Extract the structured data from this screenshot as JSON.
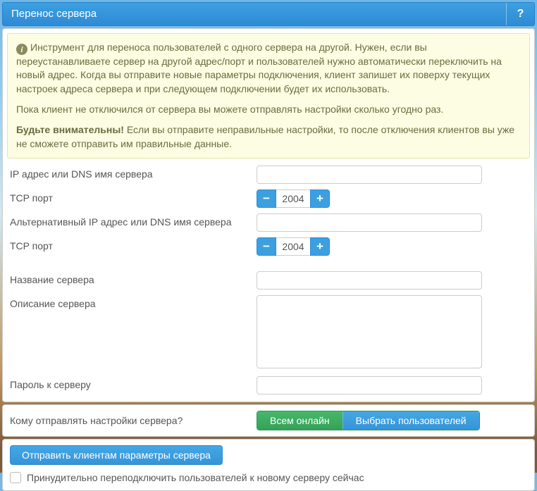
{
  "title": "Перенос сервера",
  "help_symbol": "?",
  "info": {
    "p1": "Инструмент для переноса пользователей с одного сервера на другой. Нужен, если вы переустанавливаете сервер на другой адрес/порт и пользователей нужно автоматически переключить на новый адрес. Когда вы отправите новые параметры подключения, клиент запишет их поверху текущих настроек адреса сервера и при следующем подключении будет их использовать.",
    "p2": "Пока клиент не отключился от сервера вы можете отправлять настройки сколько угодно раз.",
    "p3_prefix": "Будьте внимательны!",
    "p3_rest": " Если вы отправите неправильные настройки, то после отключения клиентов вы уже не сможете отправить им правильные данные."
  },
  "fields": {
    "ip_label": "IP адрес или DNS имя сервера",
    "ip_value": "",
    "tcp1_label": "TCP порт",
    "tcp1_value": "2004",
    "altip_label": "Альтернативный IP адрес или DNS имя сервера",
    "altip_value": "",
    "tcp2_label": "TCP порт",
    "tcp2_value": "2004",
    "name_label": "Название сервера",
    "name_value": "",
    "desc_label": "Описание сервера",
    "desc_value": "",
    "pwd_label": "Пароль к серверу",
    "pwd_value": ""
  },
  "seg": {
    "label": "Кому отправлять настройки сервера?",
    "opt1": "Всем онлайн",
    "opt2": "Выбрать пользователей"
  },
  "action": {
    "send": "Отправить клиентам параметры сервера",
    "force_label": "Принудительно переподключить пользователей к новому серверу сейчас"
  },
  "glyph": {
    "minus": "−",
    "plus": "+"
  }
}
